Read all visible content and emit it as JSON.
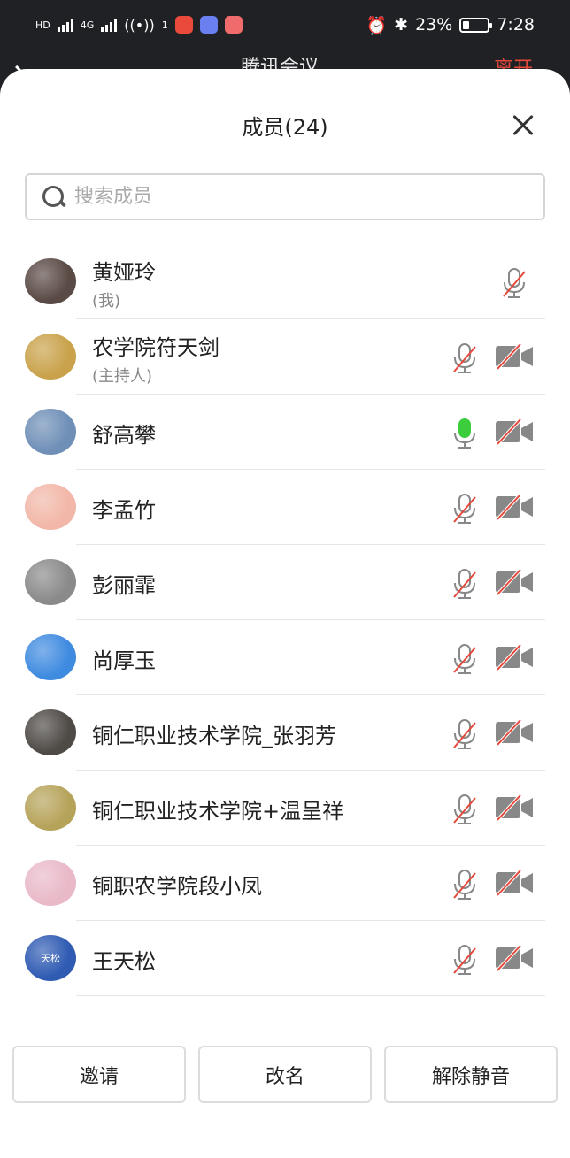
{
  "status_bar": {
    "network_left": "HD",
    "net_4g": "4G",
    "wifi_sup": "1",
    "battery": "23%",
    "time": "7:28",
    "icons": [
      "signal-icon",
      "wifi-icon",
      "alarm-icon",
      "bluetooth-icon",
      "battery-icon"
    ]
  },
  "meeting": {
    "title": "腾讯会议",
    "leave": "离开"
  },
  "panel": {
    "title": "成员(24)",
    "search_placeholder": "搜索成员"
  },
  "members": [
    {
      "name": "黄娅玲",
      "role": "(我)",
      "mic": "muted",
      "cam": "none",
      "avatar": "#5a4a45"
    },
    {
      "name": "农学院符天剑",
      "role": "(主持人)",
      "mic": "muted",
      "cam": "off",
      "avatar": "#c9a24b"
    },
    {
      "name": "舒高攀",
      "role": "",
      "mic": "active",
      "cam": "off",
      "avatar": "#6f8fb7"
    },
    {
      "name": "李孟竹",
      "role": "",
      "mic": "muted",
      "cam": "off",
      "avatar": "#f2b7a8"
    },
    {
      "name": "彭丽霏",
      "role": "",
      "mic": "muted",
      "cam": "off",
      "avatar": "#8a8a8a"
    },
    {
      "name": "尚厚玉",
      "role": "",
      "mic": "muted",
      "cam": "off",
      "avatar": "#3f8be0"
    },
    {
      "name": "铜仁职业技术学院_张羽芳",
      "role": "",
      "mic": "muted",
      "cam": "off",
      "avatar": "#4e4a46"
    },
    {
      "name": "铜仁职业技术学院+温呈祥",
      "role": "",
      "mic": "muted",
      "cam": "off",
      "avatar": "#b6a35a"
    },
    {
      "name": "铜职农学院段小凤",
      "role": "",
      "mic": "muted",
      "cam": "off",
      "avatar": "#e9b9c8"
    },
    {
      "name": "王天松",
      "role": "",
      "mic": "muted",
      "cam": "off",
      "avatar": "#2f5bb3",
      "avatar_text": "天松"
    }
  ],
  "footer": {
    "invite": "邀请",
    "rename": "改名",
    "unmute_all": "解除静音"
  },
  "colors": {
    "muted_slash": "#e5483a",
    "mic_active": "#3ccd3c",
    "icon_gray": "#888888"
  }
}
